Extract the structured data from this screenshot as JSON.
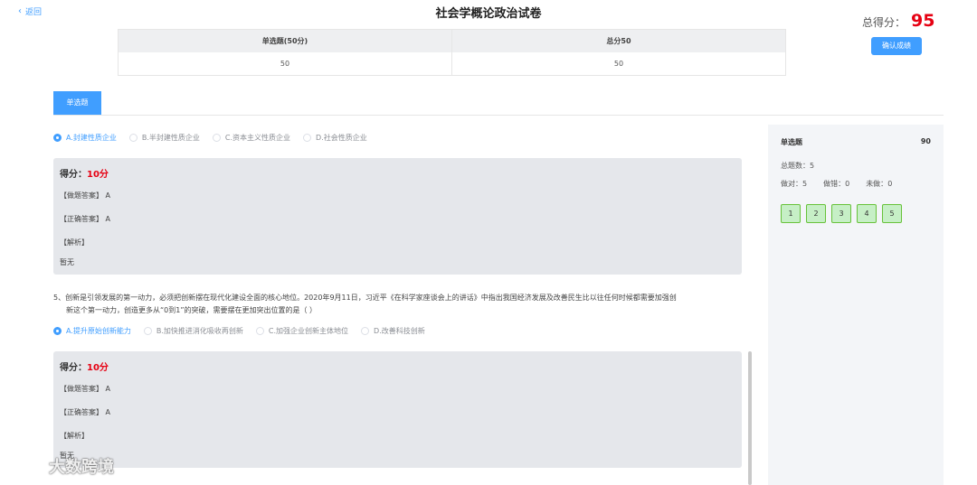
{
  "header": {
    "back_label": "返回",
    "title": "社会学概论政治试卷",
    "total_label": "总得分：",
    "total_value": "95",
    "confirm_label": "确认成绩"
  },
  "score_table": {
    "headers": [
      "单选题(50分)",
      "总分50"
    ],
    "values": [
      "50",
      "50"
    ]
  },
  "tabs": [
    {
      "label": "单选题"
    }
  ],
  "question4": {
    "options": [
      "A.封建性质企业",
      "B.半封建性质企业",
      "C.资本主义性质企业",
      "D.社会性质企业"
    ],
    "selected": 0,
    "score_label": "得分：",
    "score_value": "10分",
    "user_answer_label": "【做题答案】",
    "user_answer": "A",
    "correct_answer_label": "【正确答案】",
    "correct_answer": "A",
    "analysis_label": "【解析】",
    "analysis_text": "暂无"
  },
  "question5": {
    "stem_line1": "5、创新是引领发展的第一动力，必须把创新摆在现代化建设全面的核心地位。2020年9月11日，习近平《在科学家座谈会上的讲话》中指出我国经济发展及改善民生比以往任何时候都需要加强创",
    "stem_line2": "新这个第一动力，创造更多从“0到1”的突破，需要摆在更加突出位置的是（    ）",
    "options": [
      "A.提升原始创新能力",
      "B.加快推进消化吸收再创新",
      "C.加强企业创新主体地位",
      "D.改善科技创新"
    ],
    "selected": 0,
    "score_label": "得分：",
    "score_value": "10分",
    "user_answer_label": "【做题答案】",
    "user_answer": "A",
    "correct_answer_label": "【正确答案】",
    "correct_answer": "A",
    "analysis_label": "【解析】",
    "analysis_text": "暂无"
  },
  "sidebar": {
    "title": "单选题",
    "score": "90",
    "total_label": "总题数：",
    "total_value": "5",
    "correct_label": "做对：",
    "correct_value": "5",
    "wrong_label": "做错：",
    "wrong_value": "0",
    "undone_label": "未做：",
    "undone_value": "0",
    "numbers": [
      "1",
      "2",
      "3",
      "4",
      "5"
    ]
  },
  "watermark": {
    "text": "大数跨境"
  }
}
